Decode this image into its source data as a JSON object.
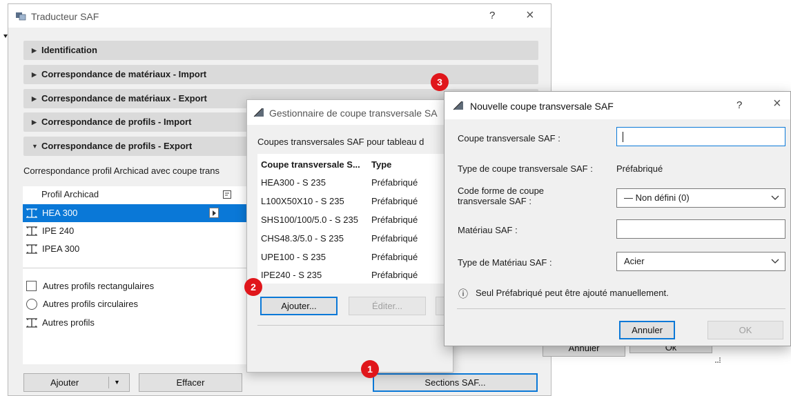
{
  "main_window": {
    "title": "Traducteur SAF",
    "help": "?",
    "close": "×",
    "sections": [
      {
        "label": "Identification",
        "arrow": "▶"
      },
      {
        "label": "Correspondance de matériaux - Import",
        "arrow": "▶"
      },
      {
        "label": "Correspondance de matériaux - Export",
        "arrow": "▶"
      },
      {
        "label": "Correspondance de profils - Import",
        "arrow": "▶"
      },
      {
        "label": "Correspondance de profils - Export",
        "arrow": "▼"
      }
    ],
    "description": "Correspondance profil Archicad avec coupe trans",
    "list_header": "Profil Archicad",
    "profiles": [
      "HEA 300",
      "IPE 240",
      "IPEA 300"
    ],
    "other_profiles": [
      "Autres profils rectangulaires",
      "Autres profils circulaires",
      "Autres profils"
    ],
    "buttons": {
      "add": "Ajouter",
      "add_menu": "▼",
      "clear": "Effacer",
      "sections": "Sections SAF..."
    }
  },
  "manager_window": {
    "title": "Gestionnaire de coupe transversale SA",
    "subtitle": "Coupes transversales SAF pour tableau d",
    "columns": [
      "Coupe transversale S...",
      "Type"
    ],
    "rows": [
      {
        "name": "HEA300 - S 235",
        "type": "Préfabriqué"
      },
      {
        "name": "L100X50X10 - S 235",
        "type": "Préfabriqué"
      },
      {
        "name": "SHS100/100/5.0 - S 235",
        "type": "Préfabriqué"
      },
      {
        "name": "CHS48.3/5.0 - S 235",
        "type": "Préfabriqué"
      },
      {
        "name": "UPE100 - S 235",
        "type": "Préfabriqué"
      },
      {
        "name": "IPE240 - S 235",
        "type": "Préfabriqué"
      }
    ],
    "buttons": {
      "add": "Ajouter...",
      "edit": "Éditer...",
      "cancel": "Annuler",
      "ok": "Ok"
    }
  },
  "new_dialog": {
    "title": "Nouvelle coupe transversale SAF",
    "help": "?",
    "close": "×",
    "labels": {
      "name": "Coupe transversale SAF :",
      "type": "Type de coupe transversale SAF :",
      "shape_line1": "Code forme de coupe",
      "shape_line2": "transversale SAF :",
      "material": "Matériau SAF :",
      "material_type": "Type de Matériau SAF :"
    },
    "values": {
      "name": "",
      "type": "Préfabriqué",
      "shape": "— Non défini (0)",
      "material": "",
      "material_type": "Acier"
    },
    "info_icon": "ⓘ",
    "info": "Seul Préfabriqué peut être ajouté manuellement.",
    "buttons": {
      "cancel": "Annuler",
      "ok": "OK"
    }
  },
  "badges": [
    "1",
    "2",
    "3"
  ],
  "colors": {
    "accent": "#0a78d7",
    "badge": "#e0161b",
    "section_bg": "#dadada"
  }
}
